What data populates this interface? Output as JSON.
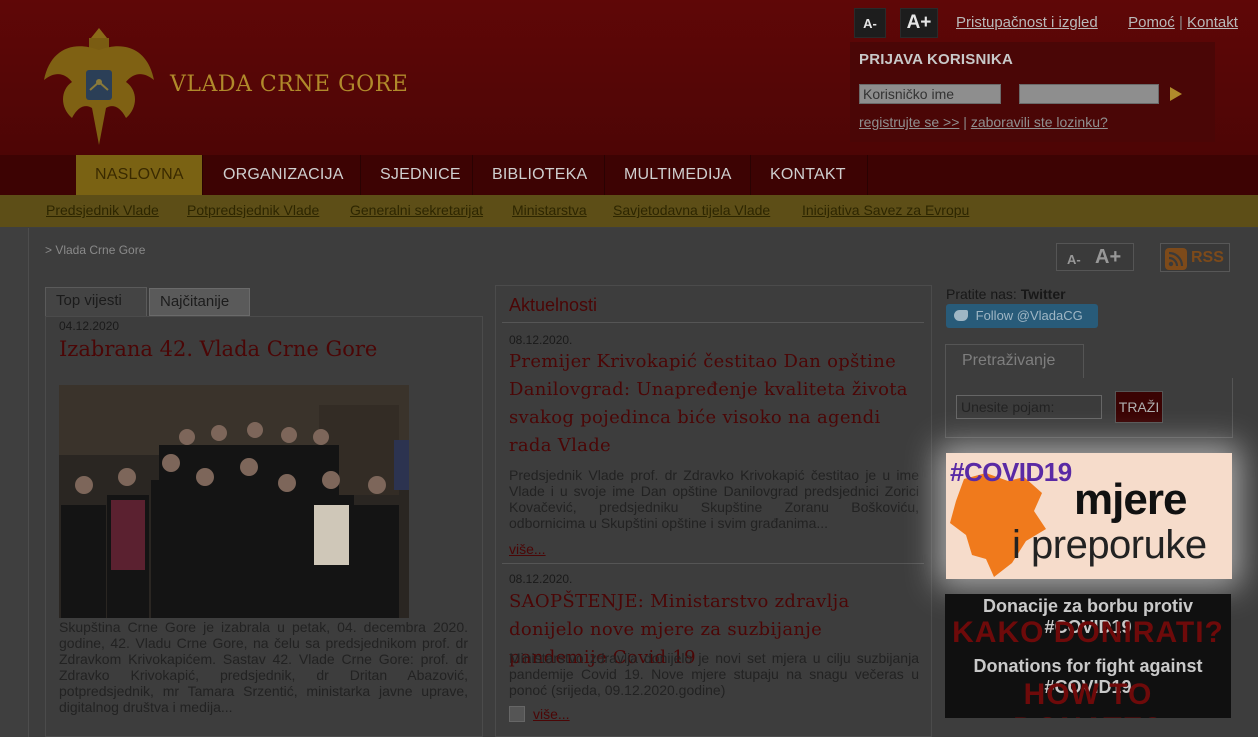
{
  "header": {
    "site_title": "VLADA CRNE GORE",
    "font_smaller": "A-",
    "font_larger": "A+",
    "accessibility_link": "Pristupačnost i izgled",
    "help_link": "Pomoć",
    "contact_link": "Kontakt",
    "separator": "|"
  },
  "login": {
    "title": "PRIJAVA KORISNIKA",
    "username_placeholder": "Korisničko ime",
    "register_link": "registrujte se >>",
    "forgot_link": "zaboravili ste lozinku?",
    "separator": "|"
  },
  "nav": {
    "items": [
      {
        "label": "NASLOVNA"
      },
      {
        "label": "ORGANIZACIJA"
      },
      {
        "label": "SJEDNICE"
      },
      {
        "label": "BIBLIOTEKA"
      },
      {
        "label": "MULTIMEDIJA"
      },
      {
        "label": "KONTAKT"
      }
    ]
  },
  "subnav": {
    "items": [
      {
        "label": "Predsjednik Vlade"
      },
      {
        "label": "Potpredsjednik Vlade"
      },
      {
        "label": "Generalni sekretarijat"
      },
      {
        "label": "Ministarstva"
      },
      {
        "label": "Savjetodavna tijela Vlade"
      },
      {
        "label": "Inicijativa Savez za Evropu"
      }
    ]
  },
  "breadcrumb": "> Vlada Crne Gore",
  "toolbar": {
    "font_smaller": "A-",
    "font_larger": "A+",
    "rss": "RSS"
  },
  "top_news": {
    "tab_top": "Top vijesti",
    "tab_most_read": "Najčitanije",
    "date": "04.12.2020",
    "title": "Izabrana 42. Vlada Crne Gore",
    "text": "Skupština Crne Gore je izabrala u petak, 04. decembra 2020. godine, 42. Vladu Crne Gore, na čelu sa predsjednikom prof. dr Zdravkom Krivokapićem. Sastav 42. Vlade Crne Gore: prof. dr Zdravko Krivokapić, predsjednik, dr Dritan Abazović, potpredsjednik, mr Tamara Srzentić, ministarka javne uprave, digitalnog društva i medija..."
  },
  "news": {
    "heading": "Aktuelnosti",
    "items": [
      {
        "date": "08.12.2020.",
        "title": "Premijer Krivokapić čestitao Dan opštine Danilovgrad: Unapređenje kvaliteta života svakog pojedinca biće visoko na agendi rada Vlade",
        "text": "Predsjednik Vlade prof. dr Zdravko Krivokapić čestitao je u ime Vlade i u svoje ime Dan opštine Danilovgrad predsjednici Zorici Kovačević, predsjedniku Skupštine Zoranu Boškoviću, odbornicima u Skupštini opštine i svim građanima...",
        "more": "više..."
      },
      {
        "date": "08.12.2020.",
        "title": "SAOPŠTENJE: Ministarstvo zdravlja donijelo nove mjere za suzbijanje pandemije Covid 19",
        "text": "Ministarstvo zdravlja donijelo je novi set mjera u cilju suzbijanja pandemije Covid 19. Nove mjere stupaju na snagu večeras u ponoć (srijeda, 09.12.2020.godine)",
        "more": "više..."
      }
    ]
  },
  "sidebar": {
    "follow_label": "Pratite nas:",
    "follow_network": "Twitter",
    "follow_button": "Follow @VladaCG",
    "search_tab": "Pretraživanje",
    "search_placeholder": "Unesite pojam:",
    "search_button": "TRAŽI",
    "covid_banner": {
      "tag": "#COVID19",
      "line1": "mjere",
      "line2": "i preporuke"
    },
    "donate_banner": {
      "line1": "Donacije za borbu protiv #COVID19",
      "line2": "KAKO DONIRATI?",
      "line3": "Donations for fight against #COVID19",
      "line4": "HOW TO DONATE?"
    }
  },
  "colors": {
    "brand_red": "#5f0707",
    "gold": "#b08a2b",
    "covid_orange": "#f07a1c",
    "covid_purple": "#5a2aa5"
  }
}
